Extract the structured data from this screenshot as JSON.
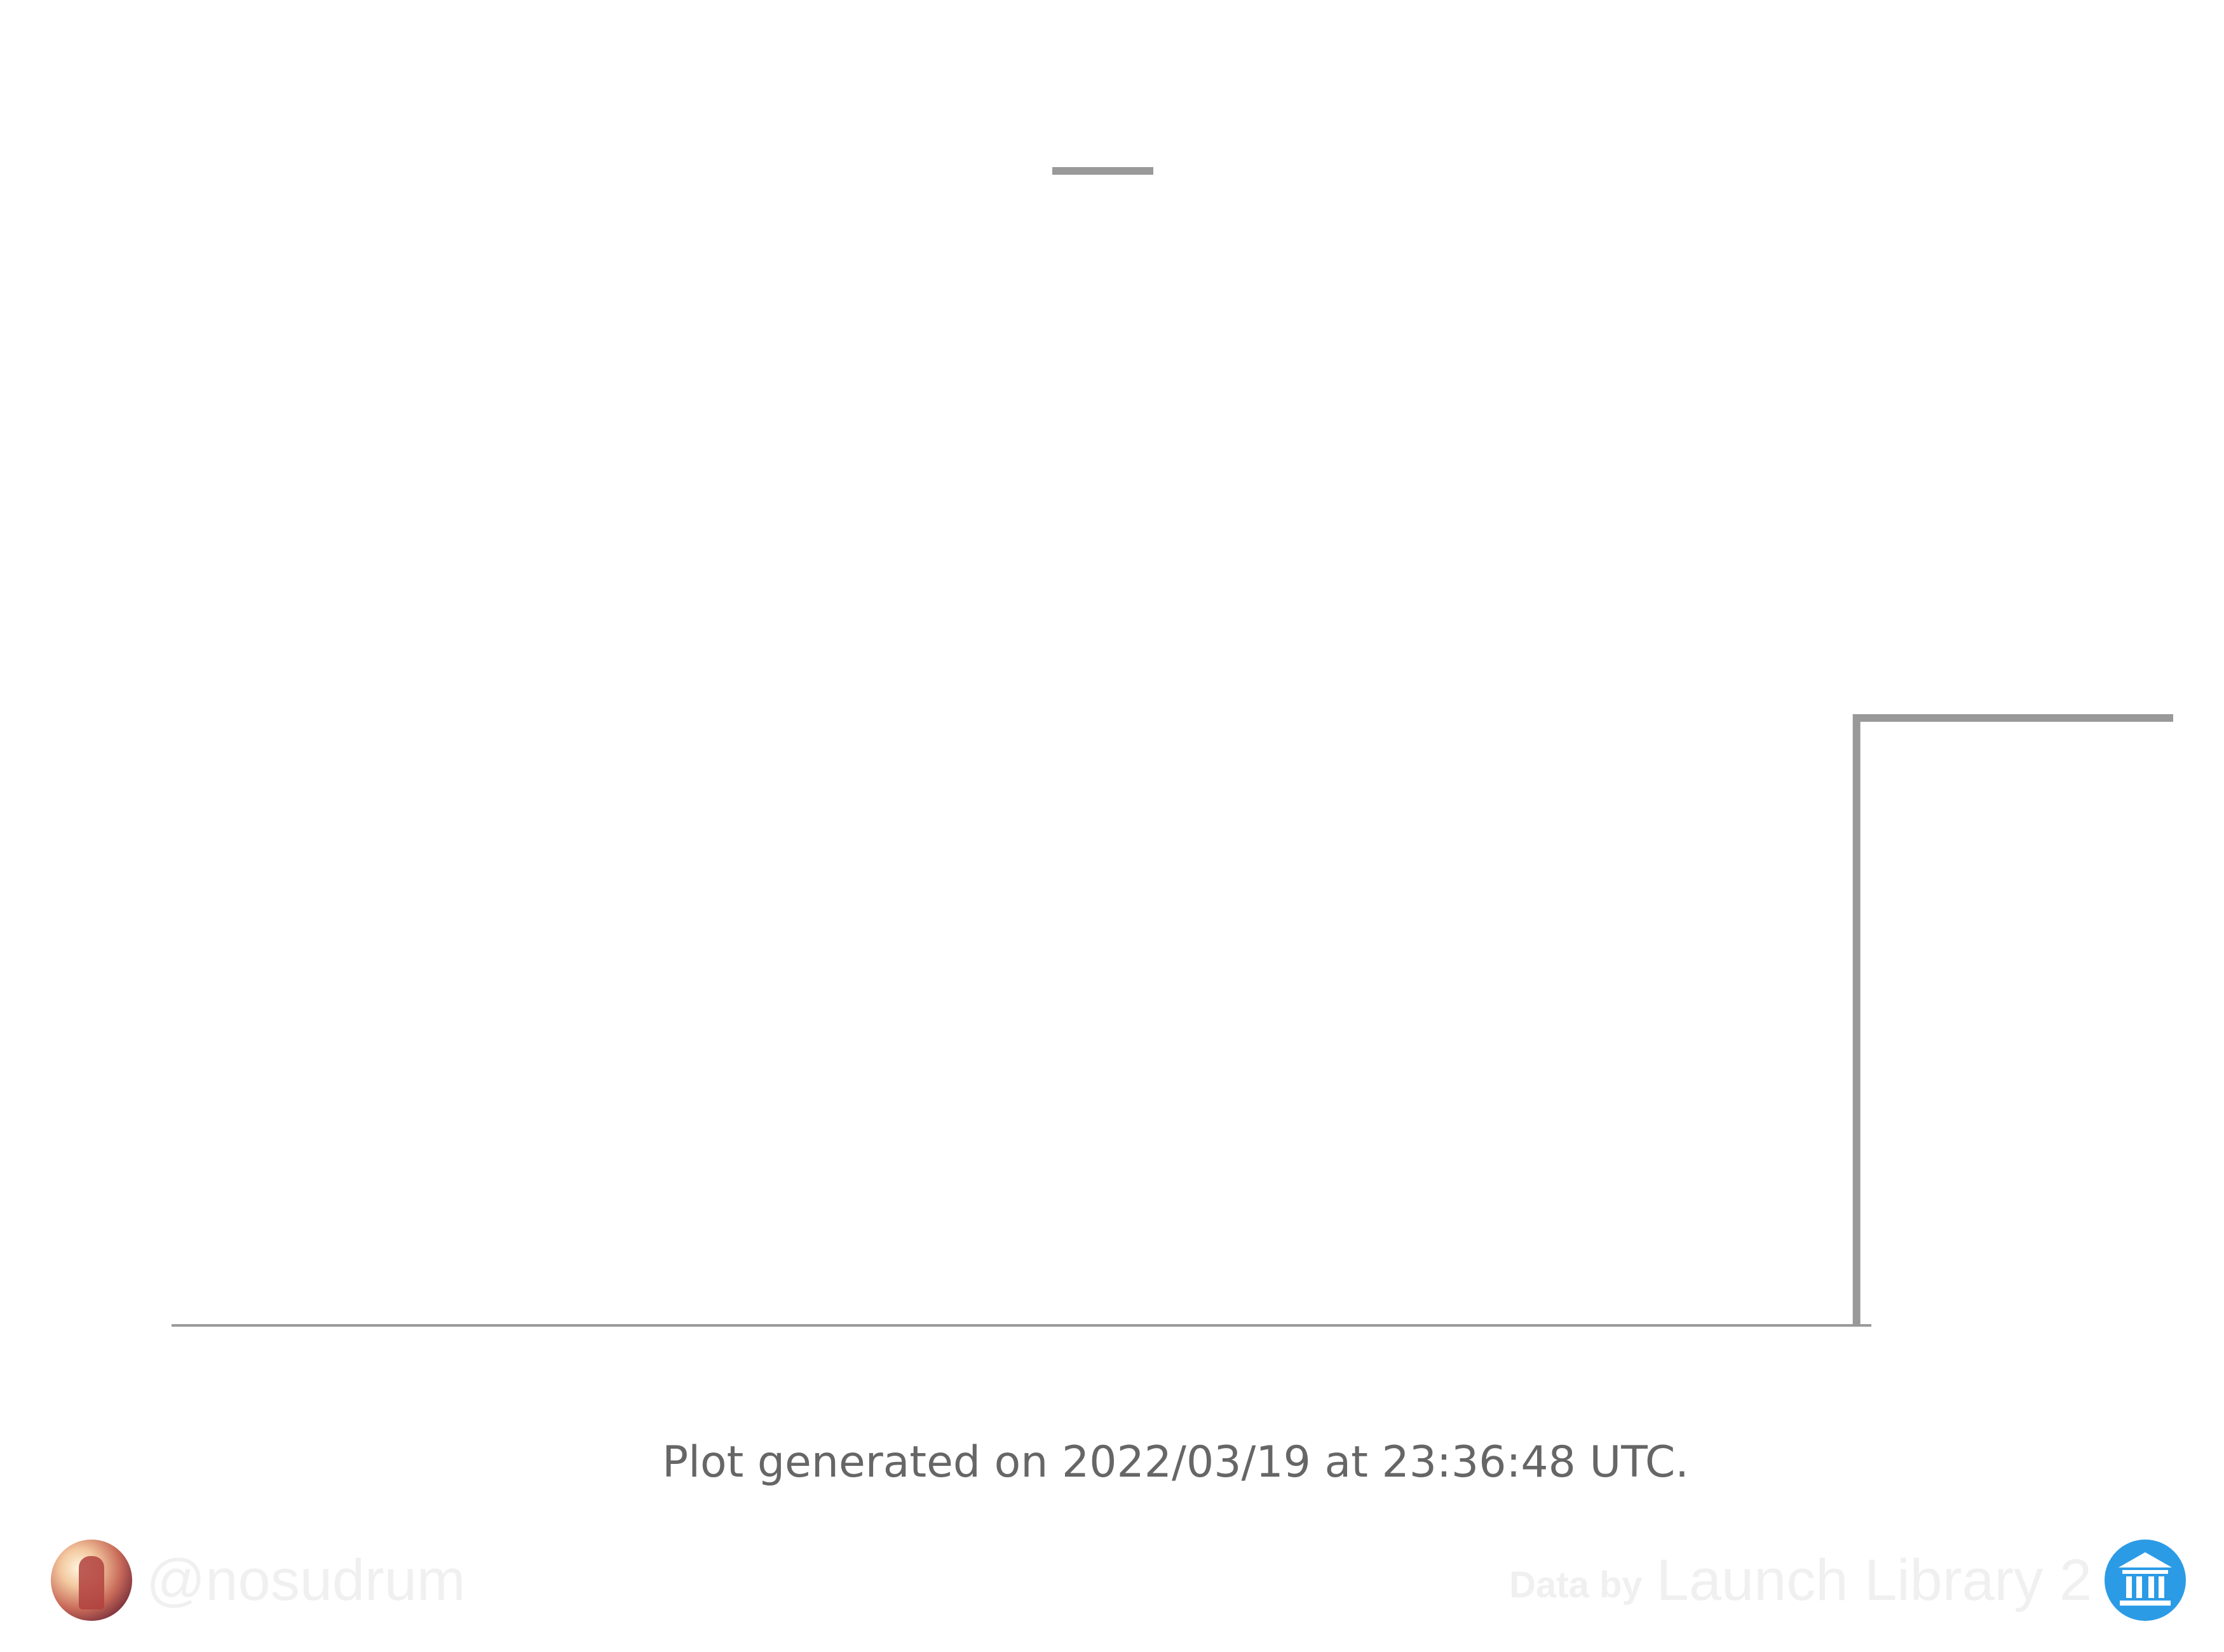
{
  "chart_data": {
    "type": "line",
    "step": true,
    "xlim": [
      0,
      1
    ],
    "ylim": [
      0,
      1
    ],
    "series": [
      {
        "x": [
          0.0,
          0.8418,
          0.8418,
          1.0
        ],
        "y": [
          0,
          0,
          1,
          1
        ]
      }
    ],
    "legend_line": true,
    "grid": false,
    "colors": {
      "line": "#999999"
    }
  },
  "footer": {
    "generated_note": "Plot generated on 2022/03/19 at 23:36:48 UTC."
  },
  "author": {
    "handle": "@nosudrum",
    "avatar_icon": "astronaut-avatar-icon"
  },
  "credit": {
    "prefix": "Data by",
    "source": "Launch Library 2",
    "logo_icon": "launch-library-logo-icon"
  }
}
